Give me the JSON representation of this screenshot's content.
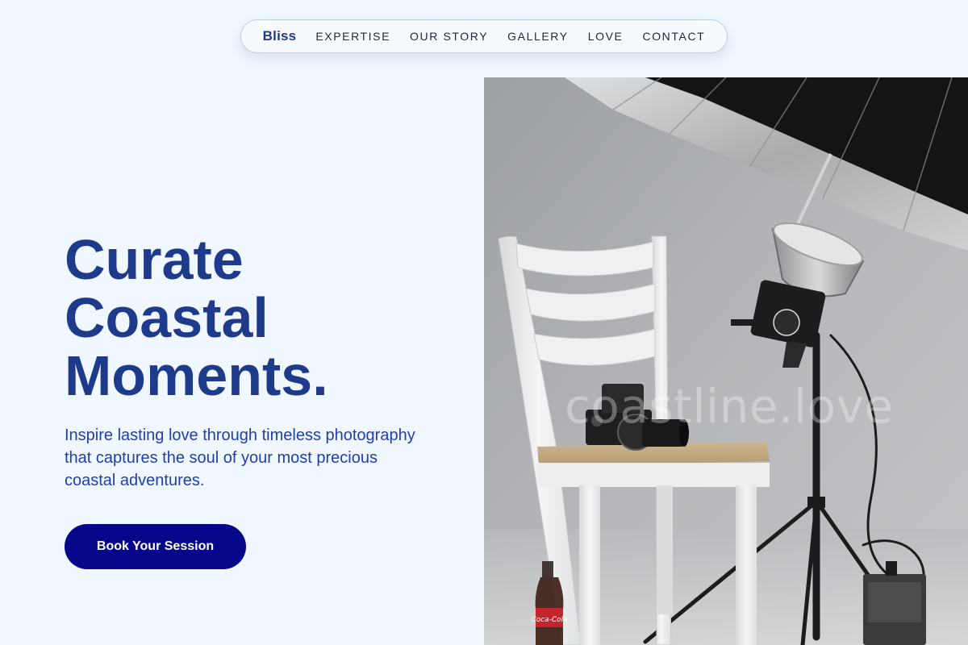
{
  "nav": {
    "brand": "Bliss",
    "links": [
      {
        "label": "EXPERTISE"
      },
      {
        "label": "OUR STORY"
      },
      {
        "label": "GALLERY"
      },
      {
        "label": "LOVE"
      },
      {
        "label": "CONTACT"
      }
    ]
  },
  "hero": {
    "title_lines": [
      "Curate",
      "Coastal",
      "Moments."
    ],
    "subtitle": "Inspire lasting love through timeless photography that captures the soul of your most precious coastal adventures.",
    "cta_label": "Book Your Session"
  },
  "photo": {
    "watermark": "coastline.love",
    "bottle_label": "Coca-Cola"
  },
  "colors": {
    "background": "#f0f7ff",
    "primary_text": "#1e3a8a",
    "cta_background": "#06068a"
  }
}
